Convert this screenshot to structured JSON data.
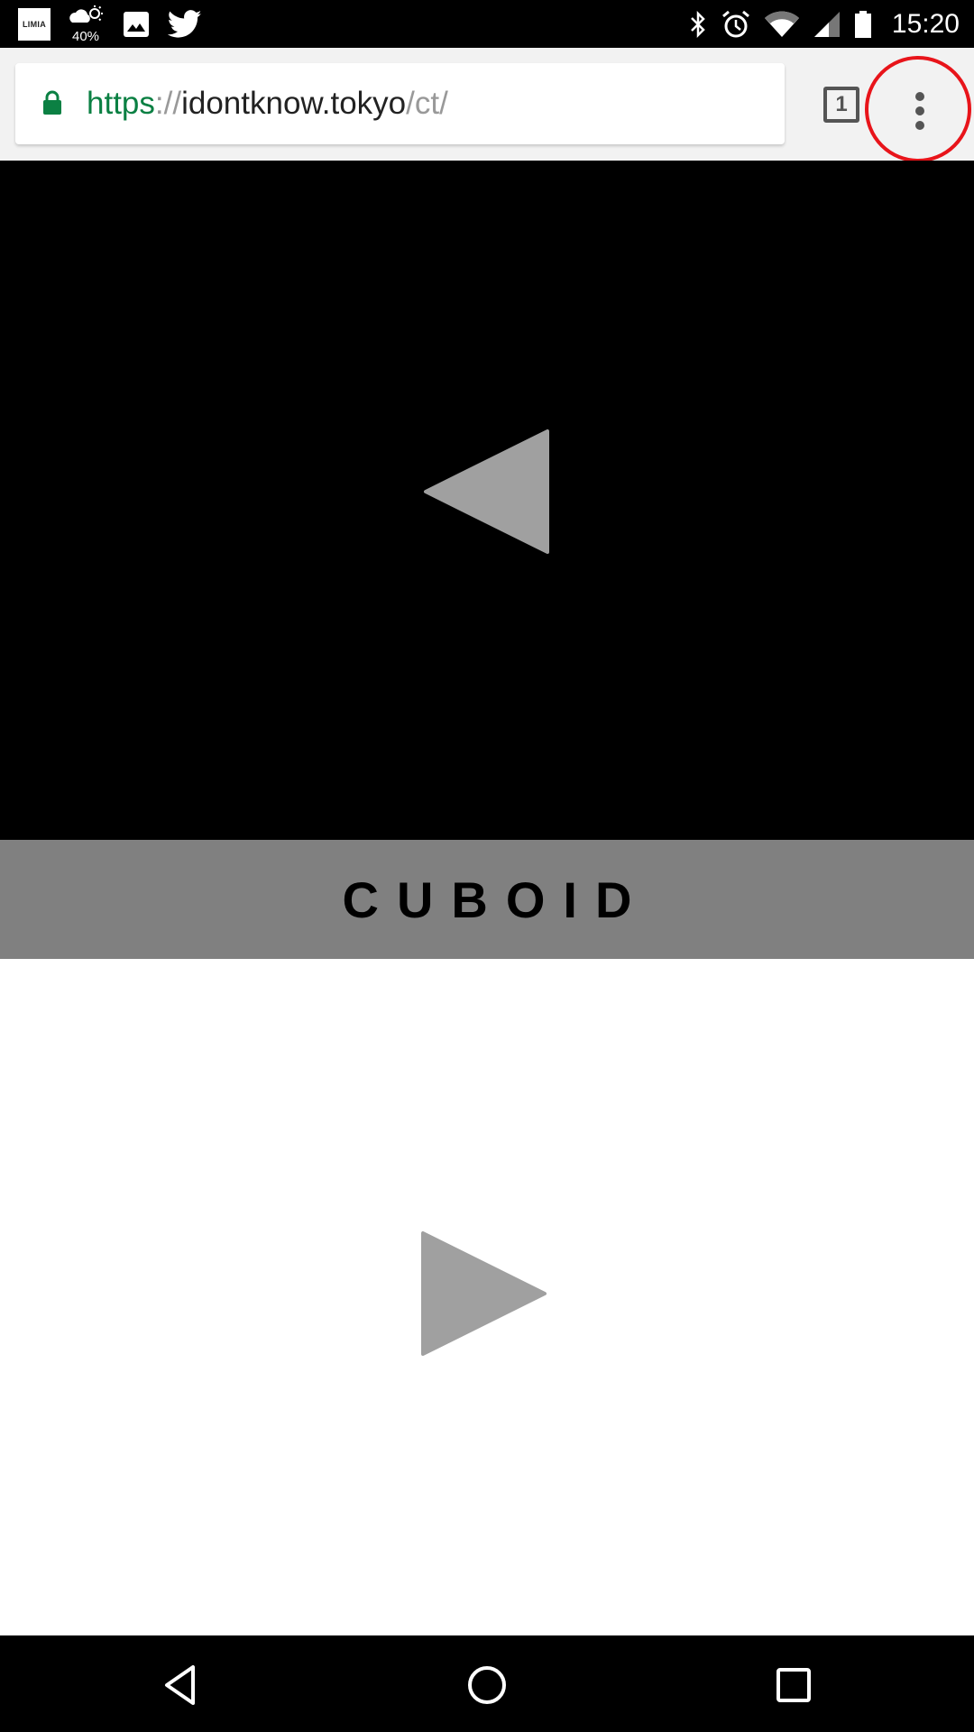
{
  "status_bar": {
    "notifications": [
      {
        "icon": "limia-app-icon",
        "label": "LIMIA"
      },
      {
        "icon": "weather-icon",
        "label": "40%"
      },
      {
        "icon": "image-icon"
      },
      {
        "icon": "twitter-icon"
      }
    ],
    "system_icons": [
      "bluetooth-icon",
      "alarm-icon",
      "wifi-icon",
      "cell-signal-icon",
      "battery-icon"
    ],
    "time": "15:20"
  },
  "browser": {
    "url": {
      "scheme": "https",
      "separator": "://",
      "host": "idontknow.tokyo",
      "path": "/ct/"
    },
    "secure": true,
    "tab_count": "1",
    "menu_highlighted": true,
    "colors": {
      "scheme_green": "#0b8043",
      "highlight_red": "#e8141a"
    }
  },
  "page": {
    "title": "CUBOID",
    "prev_arrow": "previous-arrow",
    "next_arrow": "next-arrow",
    "colors": {
      "top_panel": "#000000",
      "title_band": "#808080",
      "bottom_panel": "#ffffff",
      "arrow": "#a0a0a0"
    }
  },
  "nav_bar": {
    "buttons": [
      "back",
      "home",
      "recents"
    ]
  }
}
